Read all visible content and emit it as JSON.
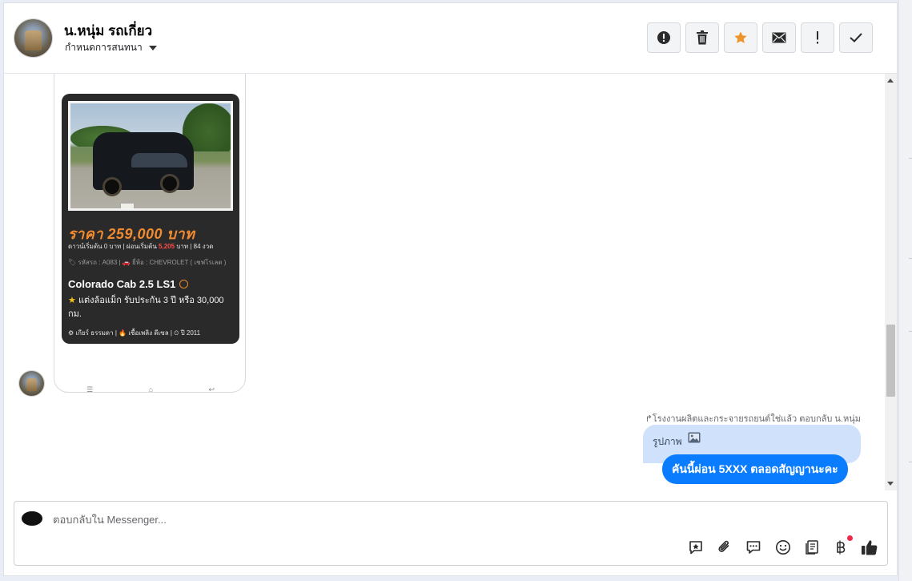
{
  "header": {
    "contact_name": "น.หนุ่ม รถเกี่ยว",
    "conversation_status": "กำหนดการสนทนา"
  },
  "toolbar": {
    "actions": [
      {
        "name": "spam-button",
        "icon": "alert-circle-icon"
      },
      {
        "name": "delete-button",
        "icon": "trash-icon"
      },
      {
        "name": "star-button",
        "icon": "star-icon",
        "color": "#f0932b"
      },
      {
        "name": "mark-unread-button",
        "icon": "envelope-icon"
      },
      {
        "name": "follow-up-button",
        "icon": "exclamation-icon"
      },
      {
        "name": "mark-done-button",
        "icon": "check-icon"
      }
    ]
  },
  "ad_card": {
    "price": "ราคา 259,000 บาท",
    "down_payment_line": {
      "prefix": "ดาวน์เริ่มต้น 0 บาท | ผ่อนเริ่มต้น",
      "installment": "5,205",
      "suffix": "บาท | 84 งวด"
    },
    "meta": "🏷 รหัสรถ : A083 | 🚗 ยี่ห้อ : CHEVROLET ( เชฟโรเลต )",
    "model": "Colorado Cab 2.5 LS1",
    "description_star": "★",
    "description": "แต่งล้อแม็ก รับประกัน 3 ปี หรือ 30,000 กม.",
    "specs": "⚙ เกียร์ ธรรมดา   |  🔥 เชื้อเพลิง ดีเซล   |  ⏲ ปี 2011"
  },
  "reply": {
    "note": "↱โรงงานผลิตและกระจายรถยนต์ใช่แล้ว ตอบกลับ น.หนุ่ม",
    "quoted_text": "รูปภาพ",
    "message": "คันนี้ผ่อน 5XXX ตลอดสัญญานะคะ"
  },
  "composer": {
    "page_badge": "",
    "placeholder": "ตอบกลับใน Messenger...",
    "value": ""
  },
  "composer_tools": [
    "saved-reply-icon",
    "paperclip-icon",
    "chat-bubbles-icon",
    "emoji-icon",
    "notes-icon",
    "baht-icon",
    "thumbs-up-icon"
  ],
  "colors": {
    "accent": "#0a7cff",
    "quoted_bubble": "#cfe1fb",
    "price_orange": "#f28b30"
  }
}
